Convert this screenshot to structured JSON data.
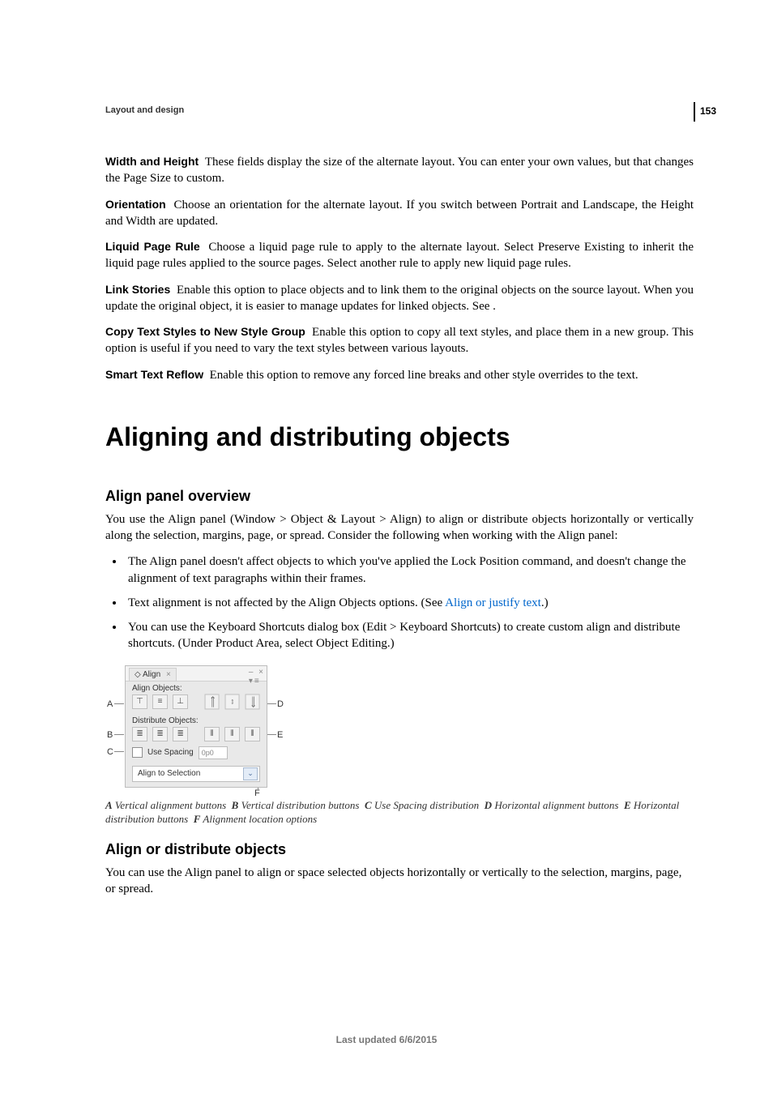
{
  "page_number": "153",
  "running_head": "Layout and design",
  "sections": {
    "width_height": {
      "term": "Width and Height",
      "text": "These fields display the size of the alternate layout. You can enter your own values, but that changes the Page Size to custom."
    },
    "orientation": {
      "term": "Orientation",
      "text": "Choose an orientation for the alternate layout. If you switch between Portrait and Landscape, the Height and Width are updated."
    },
    "liquid": {
      "term": "Liquid Page Rule",
      "text": "Choose a liquid page rule to apply to the alternate layout. Select Preserve Existing to inherit the liquid page rules applied to the source pages. Select another rule to apply new liquid page rules."
    },
    "link_stories": {
      "term": "Link Stories",
      "text": "Enable this option to place objects and to link them to the original objects on the source layout. When you update the original object, it is easier to manage updates for linked objects. See ."
    },
    "copy_styles": {
      "term": "Copy Text Styles to New Style Group",
      "text": "Enable this option to copy all text styles, and place them in a new group. This option is useful if you need to vary the text styles between various layouts."
    },
    "smart_reflow": {
      "term": "Smart Text Reflow",
      "text": "Enable this option to remove any forced line breaks and other style overrides to the text."
    }
  },
  "h1": "Aligning and distributing objects",
  "overview": {
    "heading": "Align panel overview",
    "para": "You use the Align panel (Window > Object & Layout > Align) to align or distribute objects horizontally or vertically along the selection, margins, page, or spread. Consider the following when working with the Align panel:",
    "bullets": {
      "b1": "The Align panel doesn't affect objects to which you've applied the Lock Position command, and doesn't change the alignment of text paragraphs within their frames.",
      "b2_pre": "Text alignment is not affected by the Align Objects options. (See ",
      "b2_link": "Align or justify text",
      "b2_post": ".)",
      "b3": "You can use the Keyboard Shortcuts dialog box (Edit > Keyboard Shortcuts) to create custom align and distribute shortcuts. (Under Product Area, select Object Editing.)"
    }
  },
  "panel": {
    "tab": "Align",
    "grp_align": "Align Objects:",
    "grp_dist": "Distribute Objects:",
    "use_spacing": "Use Spacing",
    "spacing_value": "0p0",
    "align_to": "Align to Selection",
    "labels": {
      "A": "A",
      "B": "B",
      "C": "C",
      "D": "D",
      "E": "E",
      "F": "F"
    },
    "icons": {
      "va_top": "⊤",
      "va_mid": "≡",
      "va_bot": "⊥",
      "ha_left": "⟸",
      "ha_ctr": "⇔",
      "ha_right": "⟹",
      "vd_top": "≣",
      "vd_mid": "≣",
      "vd_bot": "≣",
      "hd_left": "⫴",
      "hd_ctr": "⫴",
      "hd_right": "⫴"
    }
  },
  "caption": {
    "A": "A",
    "A_txt": "Vertical alignment buttons",
    "B": "B",
    "B_txt": "Vertical distribution buttons",
    "C": "C",
    "C_txt": "Use Spacing distribution",
    "D": "D",
    "D_txt": "Horizontal alignment buttons",
    "E": "E",
    "E_txt": "Horizontal distribution buttons",
    "F": "F",
    "F_txt": "Alignment location options"
  },
  "align_distribute": {
    "heading": "Align or distribute objects",
    "para": "You can use the Align panel to align or space selected objects horizontally or vertically to the selection, margins, page, or spread."
  },
  "footer": "Last updated 6/6/2015"
}
